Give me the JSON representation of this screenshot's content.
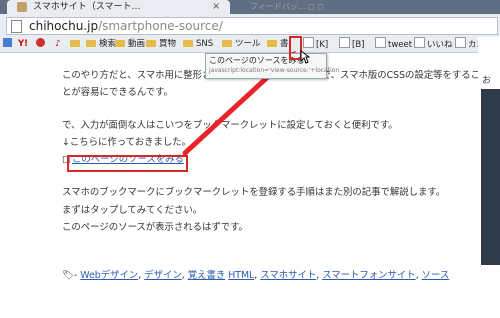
{
  "tab": {
    "title": "スマホサイト（スマート…",
    "close": "×",
    "ghost": "フィードバッ... ◻ ◻"
  },
  "url": {
    "host": "chihochu.jp",
    "path": "/smartphone-source/"
  },
  "bookmarks": [
    {
      "icon": "google",
      "label": ""
    },
    {
      "icon": "yahoo",
      "label": "Y!"
    },
    {
      "icon": "gear",
      "label": ""
    },
    {
      "icon": "bell",
      "label": ""
    },
    {
      "icon": "folder",
      "label": ""
    },
    {
      "icon": "folder",
      "label": "検索"
    },
    {
      "icon": "folder",
      "label": "動画"
    },
    {
      "icon": "folder",
      "label": "買物"
    },
    {
      "icon": "folder",
      "label": "SNS"
    },
    {
      "icon": "folder",
      "label": "ツール"
    },
    {
      "icon": "folder",
      "label": "書"
    },
    {
      "icon": "page",
      "label": "[K]"
    },
    {
      "icon": "page",
      "label": "[B]"
    },
    {
      "icon": "page",
      "label": "tweet"
    },
    {
      "icon": "page",
      "label": "いいね"
    },
    {
      "icon": "page",
      "label": "カエル"
    }
  ],
  "tooltip": {
    "line1": "このページのソースをみる",
    "line2": "javascript:location='view-source:'+location"
  },
  "content": {
    "p1a": "このやり方だと、スマホ用に整形されたHTMLが確認できるので、スマホ版のCSSの設定等をするこ",
    "p1b": "とが容易にできるんです。",
    "p2a": "で、入力が面倒な人はこいつをブックマークレットに設定しておくと便利です。",
    "p2b": "↓こちらに作っておきました。",
    "bullet": "□",
    "link": "このページのソースをみる",
    "p3a": "スマホのブックマークにブックマークレットを登録する手順はまた別の記事で解説します。",
    "p3b": "まずはタップしてみてください。",
    "p3c": "このページのソースが表示されるはずです。",
    "tag_prefix": "- ",
    "tags": [
      "Webデザイン",
      "デザイン",
      "覚え書き",
      "HTML",
      "スマホサイト",
      "スマートフォンサイト",
      "ソース"
    ],
    "tag_sep": ", "
  },
  "right": {
    "mark": "お"
  },
  "colors": {
    "highlight": "#d62728",
    "link": "#2a5db0",
    "tabstrip": "#5f6e83"
  }
}
